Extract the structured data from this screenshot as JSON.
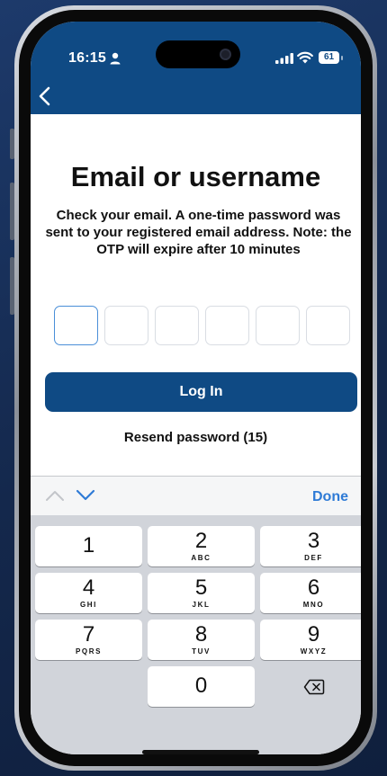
{
  "status_bar": {
    "time": "16:15",
    "battery": "61"
  },
  "header": {
    "back_icon": "chevron-left-icon"
  },
  "main": {
    "title": "Email or username",
    "instructions": "Check your email. A one-time password was sent to your registered email address. Note: the OTP will expire after 10 minutes",
    "otp_digit_count": 6,
    "otp_values": [
      "",
      "",
      "",
      "",
      "",
      ""
    ],
    "login_label": "Log In",
    "resend_label": "Resend password (15)"
  },
  "keyboard": {
    "done_label": "Done",
    "keys": [
      {
        "digit": "1",
        "letters": ""
      },
      {
        "digit": "2",
        "letters": "ABC"
      },
      {
        "digit": "3",
        "letters": "DEF"
      },
      {
        "digit": "4",
        "letters": "GHI"
      },
      {
        "digit": "5",
        "letters": "JKL"
      },
      {
        "digit": "6",
        "letters": "MNO"
      },
      {
        "digit": "7",
        "letters": "PQRS"
      },
      {
        "digit": "8",
        "letters": "TUV"
      },
      {
        "digit": "9",
        "letters": "WXYZ"
      },
      {
        "digit": "0",
        "letters": ""
      }
    ],
    "delete_icon": "backspace-icon"
  },
  "colors": {
    "brand_blue": "#0f4a84",
    "link_blue": "#2f7bd6",
    "focus_border": "#4a8fd8"
  }
}
